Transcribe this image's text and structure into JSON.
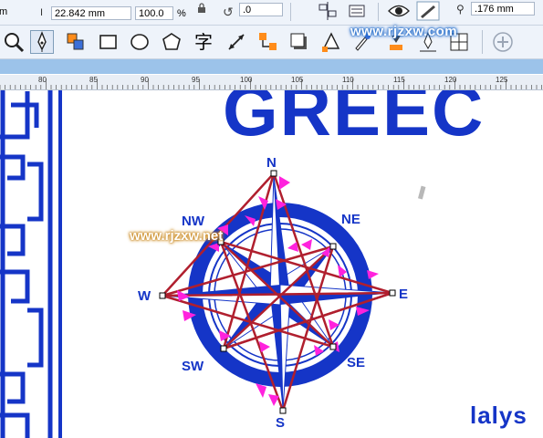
{
  "property_bar": {
    "unit_fragment": "m",
    "height_value": "22.842 mm",
    "scale_value": "100.0",
    "percent_sign": "%",
    "rotation_value": ".0",
    "outline_width": ".176 mm"
  },
  "toolbar": {
    "tools": [
      "zoom-tool",
      "freehand-tool",
      "smart-fill-tool",
      "rectangle-tool",
      "ellipse-tool",
      "polygon-tool",
      "text-tool",
      "parallel-dimension-tool",
      "connector-tool",
      "drop-shadow-tool",
      "transparency-tool",
      "color-eyedropper-tool",
      "interactive-fill-tool",
      "smart-drawing-tool",
      "add-tool"
    ],
    "watermark": "www.rjzxw.com"
  },
  "ruler": {
    "ticks": [
      "80",
      "85",
      "90",
      "95",
      "100",
      "105",
      "110",
      "115",
      "120",
      "125"
    ]
  },
  "canvas": {
    "title_text": "GREEC",
    "footer_text": "lalys",
    "compass": {
      "north": "N",
      "northeast": "NE",
      "east": "E",
      "southeast": "SE",
      "south": "S",
      "southwest": "SW",
      "west": "W",
      "northwest": "NW"
    },
    "watermark": "www.rjzxw.net"
  },
  "colors": {
    "ink_blue": "#1535c7",
    "guide_red": "#b01f2e",
    "arrow_magenta": "#ff22dd",
    "ui_bg": "#eef3fa",
    "strip_blue": "#9cc3ea"
  }
}
